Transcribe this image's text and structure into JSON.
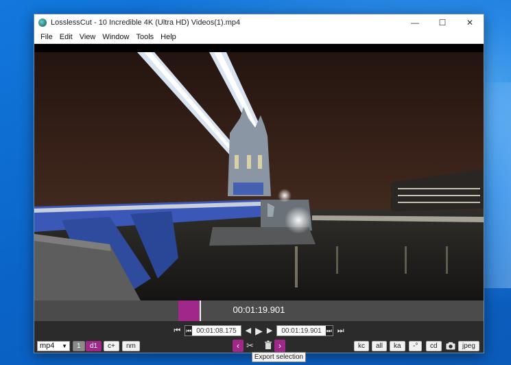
{
  "window": {
    "title": "LosslessCut - 10 Incredible 4K (Ultra HD) Videos(1).mp4",
    "controls": {
      "minimize": "—",
      "maximize": "☐",
      "close": "✕"
    }
  },
  "menu": [
    "File",
    "Edit",
    "View",
    "Window",
    "Tools",
    "Help"
  ],
  "timeline": {
    "current_time": "00:01:19.901",
    "segment_start_fraction": 0.32,
    "segment_end_fraction": 0.37
  },
  "transport": {
    "cut_start_time": "00:01:08.175",
    "cut_end_time": "00:01:19.901"
  },
  "bottom_bar": {
    "format": "mp4",
    "segment_count": "1",
    "buttons_left": [
      "d1",
      "c+",
      "nm"
    ],
    "buttons_right": [
      "kc",
      "all",
      "ka",
      "-°",
      "cd",
      "jpeg"
    ]
  },
  "tooltip": "Export selection",
  "colors": {
    "accent": "#a0288a",
    "timeline_bg": "#4b4b4b",
    "controls_bg": "#2b2b2b"
  }
}
